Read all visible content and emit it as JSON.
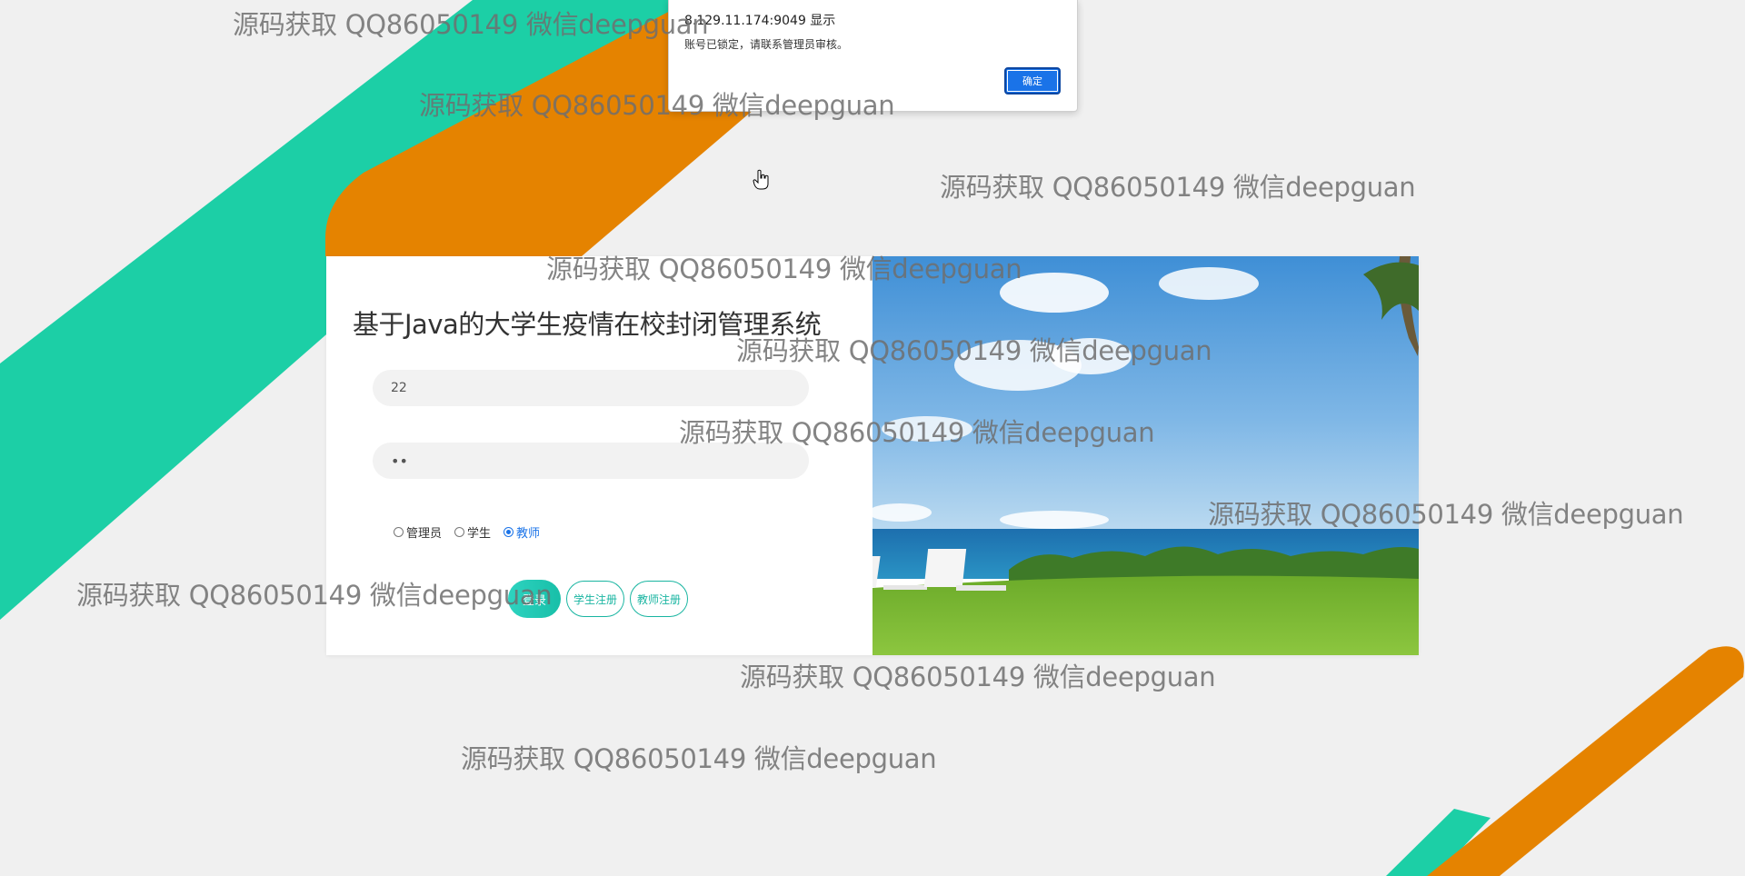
{
  "login": {
    "title": "基于Java的大学生疫情在校封闭管理系统",
    "username_value": "22",
    "password_value": "••",
    "roles": [
      {
        "label": "管理员",
        "checked": false
      },
      {
        "label": "学生",
        "checked": false
      },
      {
        "label": "教师",
        "checked": true
      }
    ],
    "login_button": "登录",
    "student_register": "学生注册",
    "teacher_register": "教师注册"
  },
  "alert": {
    "origin": "8.129.11.174:9049 显示",
    "message": "账号已锁定，请联系管理员审核。",
    "ok_label": "确定"
  },
  "watermark": "源码获取 QQ86050149 微信deepguan",
  "colors": {
    "teal": "#1ccfa6",
    "orange": "#e58300",
    "background": "#f0f0f0",
    "accent_blue": "#1a73e8"
  },
  "icons": {
    "cursor": "hand-pointer-icon"
  }
}
